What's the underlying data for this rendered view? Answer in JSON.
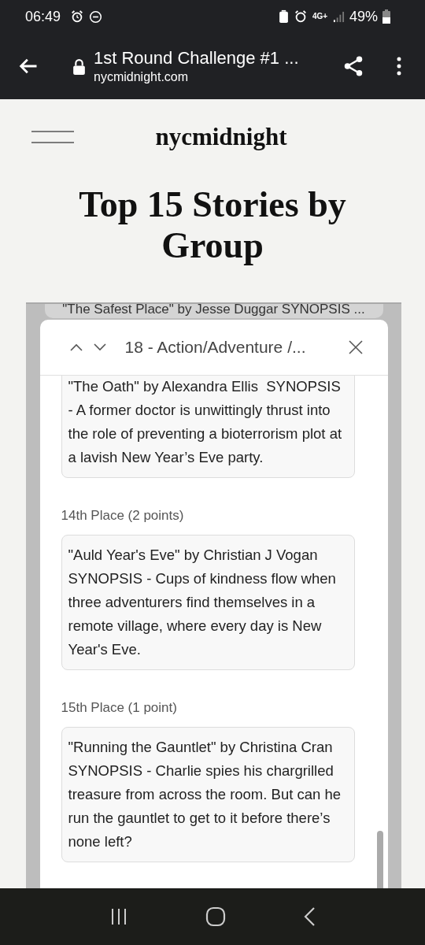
{
  "status_bar": {
    "time": "06:49",
    "network": "4G+",
    "battery": "49%"
  },
  "browser": {
    "page_title": "1st Round Challenge #1 ...",
    "domain": "nycmidnight.com"
  },
  "site": {
    "logo": "nycmidnight",
    "heading": "Top 15 Stories by Group"
  },
  "background_entry": "\"The Safest Place\" by Jesse Duggar SYNOPSIS ...",
  "dialog": {
    "title": "18 - Action/Adventure /...",
    "entries": [
      {
        "text": "\"The Oath\" by Alexandra Ellis  SYNOPSIS - A former doctor is unwittingly thrust into the role of preventing a bioterrorism plot at a lavish New Year’s Eve party."
      },
      {
        "place": "14th Place (2 points)",
        "text": "\"Auld Year's Eve\" by Christian J Vogan SYNOPSIS - Cups of kindness flow when three adventurers find themselves in a remote village, where every day is New Year's Eve."
      },
      {
        "place": "15th Place (1 point)",
        "text": "\"Running the Gauntlet\" by Christina Cran SYNOPSIS - Charlie spies his chargrilled treasure from across the room. But can he run the gauntlet to get to it before there’s none left?"
      }
    ]
  }
}
